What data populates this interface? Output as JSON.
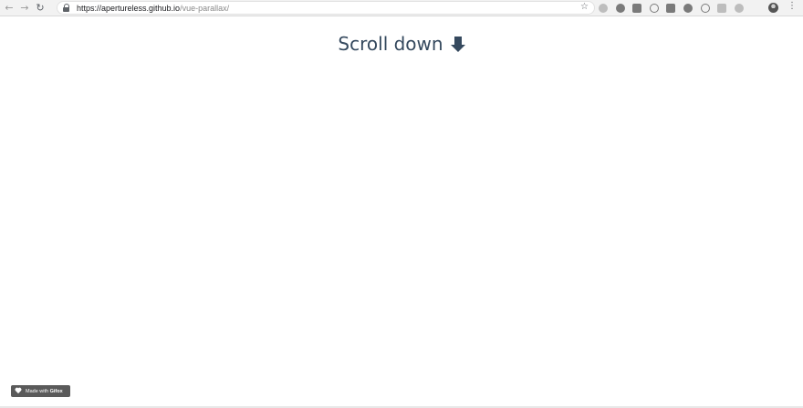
{
  "browser": {
    "url_host": "https://apertureless.github.io",
    "url_path": "/vue-parallax/",
    "back_icon": "arrow-left-icon",
    "forward_icon": "arrow-right-icon",
    "reload_icon": "reload-icon",
    "bookmark_icon": "star-icon",
    "menu_icon": "more-vertical-icon"
  },
  "page": {
    "heading": "Scroll down",
    "heading_icon": "arrow-down-icon",
    "heading_color": "#35495e"
  },
  "badge": {
    "prefix": "Made with",
    "brand": "Gifox",
    "icon": "heart-icon"
  }
}
